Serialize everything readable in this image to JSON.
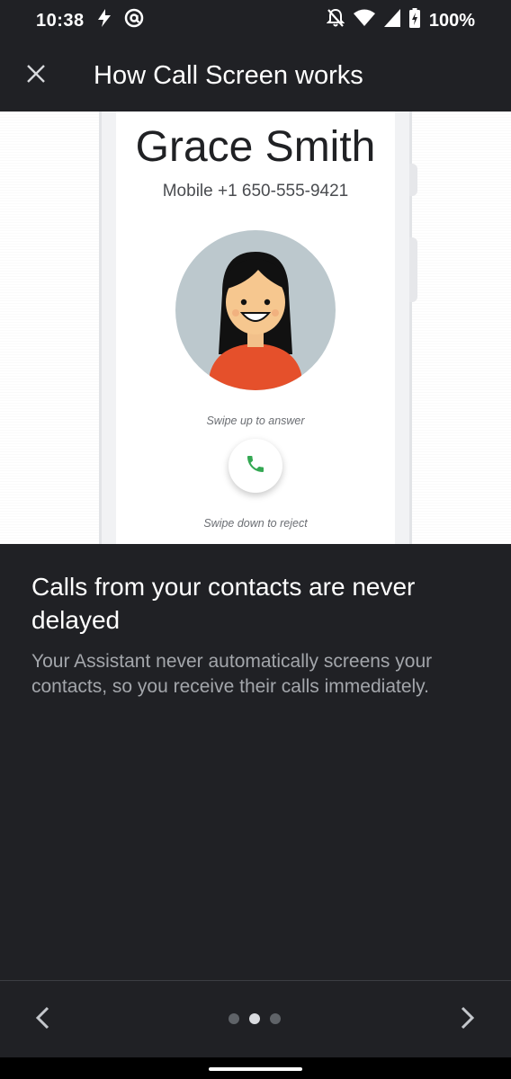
{
  "status_bar": {
    "time": "10:38",
    "battery": "100%",
    "icons": [
      "bolt-icon",
      "at-sign-icon",
      "notifications-off-icon",
      "wifi-icon",
      "signal-icon",
      "battery-icon"
    ]
  },
  "app_bar": {
    "title": "How Call Screen works",
    "close_icon": "close-icon"
  },
  "illustration": {
    "caller_name": "Grace Smith",
    "caller_number": "Mobile +1 650-555-9421",
    "swipe_up_text": "Swipe up to answer",
    "swipe_down_text": "Swipe down to reject",
    "answer_icon": "phone-icon",
    "answer_color": "#34a853",
    "avatar_bg": "#bcc8cd",
    "shirt_color": "#e5502b"
  },
  "content": {
    "heading": "Calls from your contacts are never delayed",
    "body": "Your Assistant never automatically screens your contacts, so you receive their calls immediately."
  },
  "pager": {
    "prev_icon": "chevron-left-icon",
    "next_icon": "chevron-right-icon",
    "page_count": 3,
    "current_page": 2
  },
  "colors": {
    "background": "#202125",
    "text_primary": "#ffffff",
    "text_secondary": "#a3a6ab"
  }
}
